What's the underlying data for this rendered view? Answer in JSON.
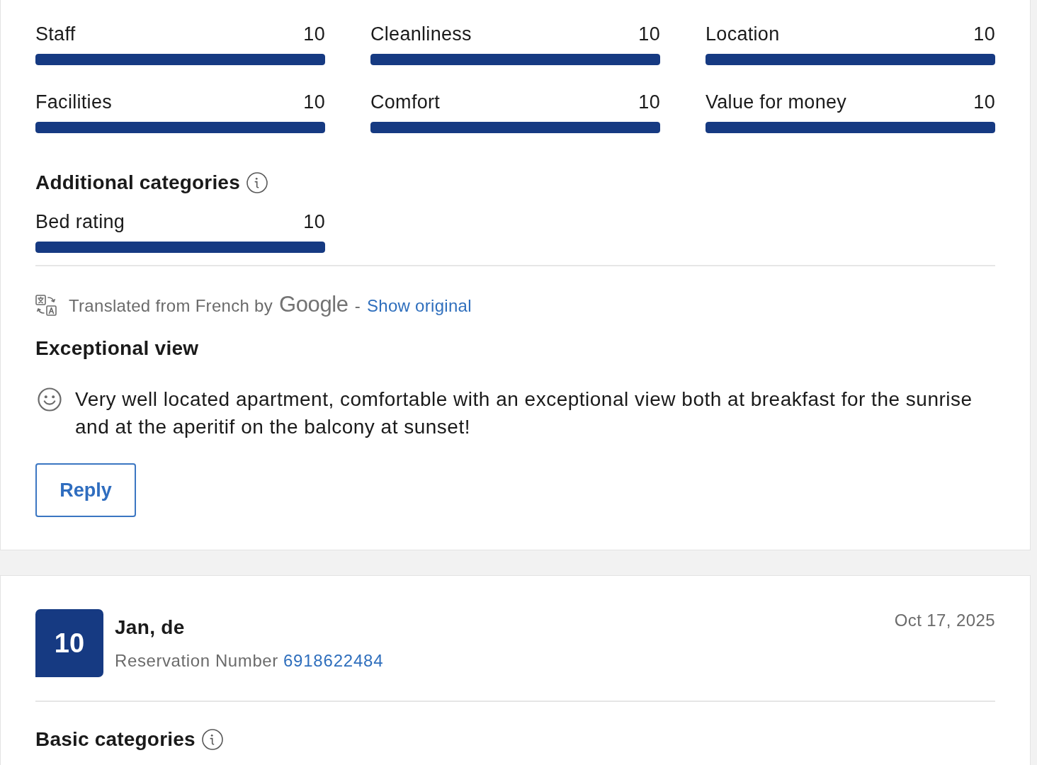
{
  "reviews": [
    {
      "basic_categories": {
        "items": [
          {
            "label": "Staff",
            "score": "10",
            "level": 1
          },
          {
            "label": "Cleanliness",
            "score": "10",
            "level": 1
          },
          {
            "label": "Location",
            "score": "10",
            "level": 1
          },
          {
            "label": "Facilities",
            "score": "10",
            "level": 1
          },
          {
            "label": "Comfort",
            "score": "10",
            "level": 1
          },
          {
            "label": "Value for money",
            "score": "10",
            "level": 1
          }
        ]
      },
      "additional_categories": {
        "heading": "Additional categories",
        "items": [
          {
            "label": "Bed rating",
            "score": "10",
            "level": 1
          }
        ]
      },
      "translation": {
        "text": "Translated from French by",
        "provider": "Google",
        "separator": "-",
        "link": "Show original"
      },
      "title": "Exceptional view",
      "comments": [
        {
          "kind": "positive",
          "text": "Very well located apartment, comfortable with an exceptional view both at breakfast for the sunrise and at the aperitif on the balcony at sunset!"
        }
      ],
      "reply_button": "Reply"
    },
    {
      "score": "10",
      "guest": "Jan, de",
      "reservation_label": "Reservation Number",
      "reservation_number": "6918622484",
      "date": "Oct 17, 2025",
      "basic_categories": {
        "heading": "Basic categories"
      }
    }
  ]
}
